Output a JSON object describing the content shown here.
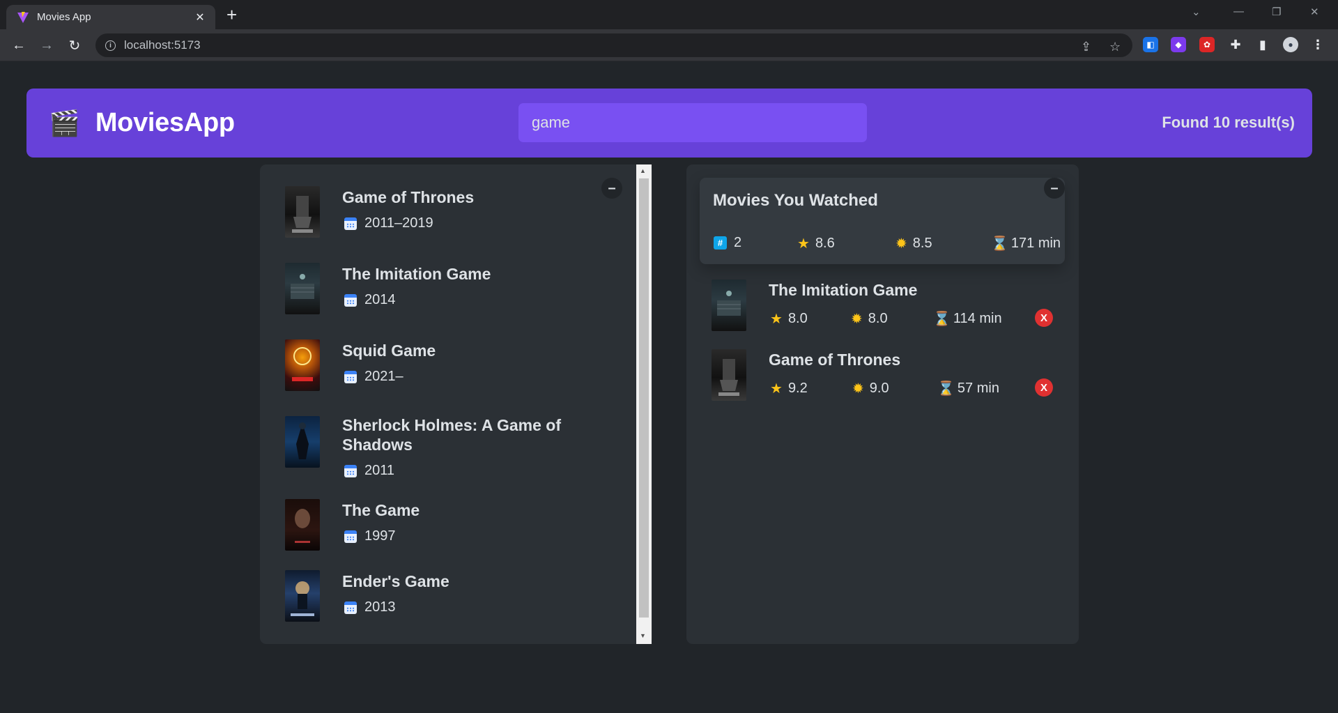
{
  "browser": {
    "tab_title": "Movies App",
    "url": "localhost:5173"
  },
  "app": {
    "logo_icon": "🎬",
    "logo_text": "MoviesApp",
    "search_value": "game",
    "results_text": "Found 10 result(s)"
  },
  "search_results": [
    {
      "title": "Game of Thrones",
      "year": "2011–2019",
      "calendar_icon": "calendar-icon"
    },
    {
      "title": "The Imitation Game",
      "year": "2014",
      "calendar_icon": "calendar-icon"
    },
    {
      "title": "Squid Game",
      "year": "2021–",
      "calendar_icon": "calendar-icon"
    },
    {
      "title": "Sherlock Holmes: A Game of Shadows",
      "year": "2011",
      "calendar_icon": "calendar-icon"
    },
    {
      "title": "The Game",
      "year": "1997",
      "calendar_icon": "calendar-icon"
    },
    {
      "title": "Ender's Game",
      "year": "2013",
      "calendar_icon": "calendar-icon"
    }
  ],
  "watched_summary": {
    "title": "Movies You Watched",
    "count": "2",
    "avg_imdb": "8.6",
    "avg_user": "8.5",
    "avg_runtime": "171 min"
  },
  "watched": [
    {
      "title": "The Imitation Game",
      "imdb": "8.0",
      "user": "8.0",
      "runtime": "114 min",
      "delete_label": "X"
    },
    {
      "title": "Game of Thrones",
      "imdb": "9.2",
      "user": "9.0",
      "runtime": "57 min",
      "delete_label": "X"
    }
  ],
  "toggle_label": "–",
  "colors": {
    "primary": "#6741d9",
    "primary_light": "#7950f2",
    "background": "#212529",
    "box": "#2b3035",
    "danger": "#e03131"
  }
}
